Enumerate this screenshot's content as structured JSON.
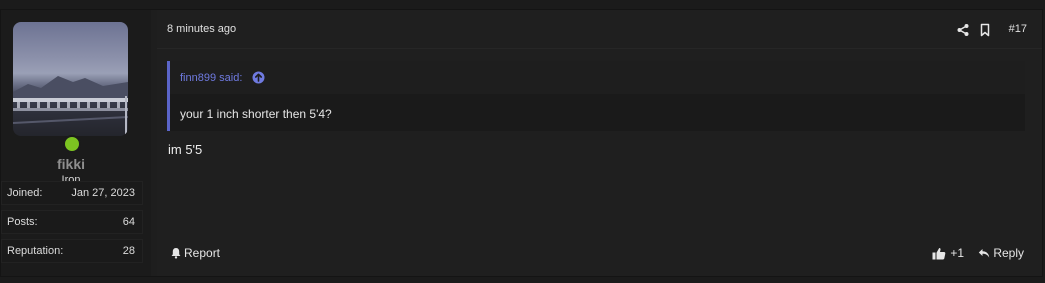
{
  "post": {
    "timestamp": "8 minutes ago",
    "post_number": "#17",
    "quote": {
      "author_label": "finn899 said:",
      "text": "your 1 inch shorter then 5'4?"
    },
    "message": "im 5'5",
    "actions": {
      "report_label": "Report",
      "like_label": "+1",
      "reply_label": "Reply"
    }
  },
  "user": {
    "name": "fikki",
    "title": "Iron",
    "online_color": "#7cc421",
    "stats": [
      {
        "label": "Joined:",
        "value": "Jan 27, 2023"
      },
      {
        "label": "Posts:",
        "value": "64"
      },
      {
        "label": "Reputation:",
        "value": "28"
      }
    ]
  },
  "colors": {
    "quote_accent": "#5b65c9",
    "quote_author": "#6f7ae0"
  },
  "icons": [
    "share-icon",
    "bookmark-icon",
    "arrow-up-circle-icon",
    "bell-icon",
    "thumbs-up-icon",
    "reply-arrow-icon"
  ]
}
